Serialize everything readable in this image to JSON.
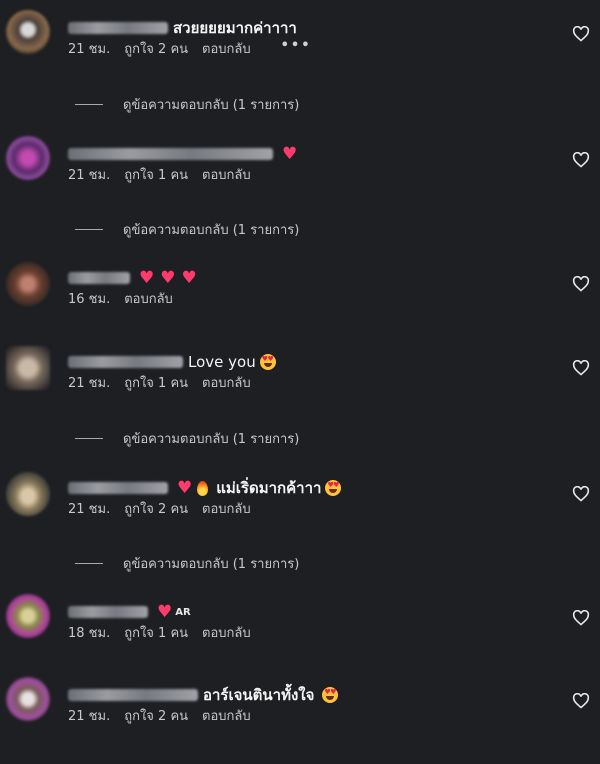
{
  "comments": [
    {
      "text": "สวยยยยมากค่าาาา",
      "time": "21 ชม.",
      "likes": "ถูกใจ 2 คน",
      "reply": "ตอบกลับ",
      "more": "•••"
    },
    {
      "text": "",
      "time": "21 ชม.",
      "likes": "ถูกใจ 1 คน",
      "reply": "ตอบกลับ"
    },
    {
      "text": "",
      "time": "16 ชม.",
      "reply": "ตอบกลับ"
    },
    {
      "text": "Love you",
      "time": "21 ชม.",
      "likes": "ถูกใจ 1 คน",
      "reply": "ตอบกลับ"
    },
    {
      "text": "แม่เริ่ดมากค้าาา",
      "time": "21 ชม.",
      "likes": "ถูกใจ 2 คน",
      "reply": "ตอบกลับ"
    },
    {
      "text": "",
      "badge": "AR",
      "time": "18 ชม.",
      "likes": "ถูกใจ 1 คน",
      "reply": "ตอบกลับ"
    },
    {
      "text": "อาร์เจนตินาทั้งใจ",
      "time": "21 ชม.",
      "likes": "ถูกใจ 2 คน",
      "reply": "ตอบกลับ"
    }
  ],
  "view_replies": "ดูข้อความตอบกลับ (1 รายการ)",
  "icons": {
    "like": "heart-outline-icon",
    "more": "more-options-icon"
  }
}
